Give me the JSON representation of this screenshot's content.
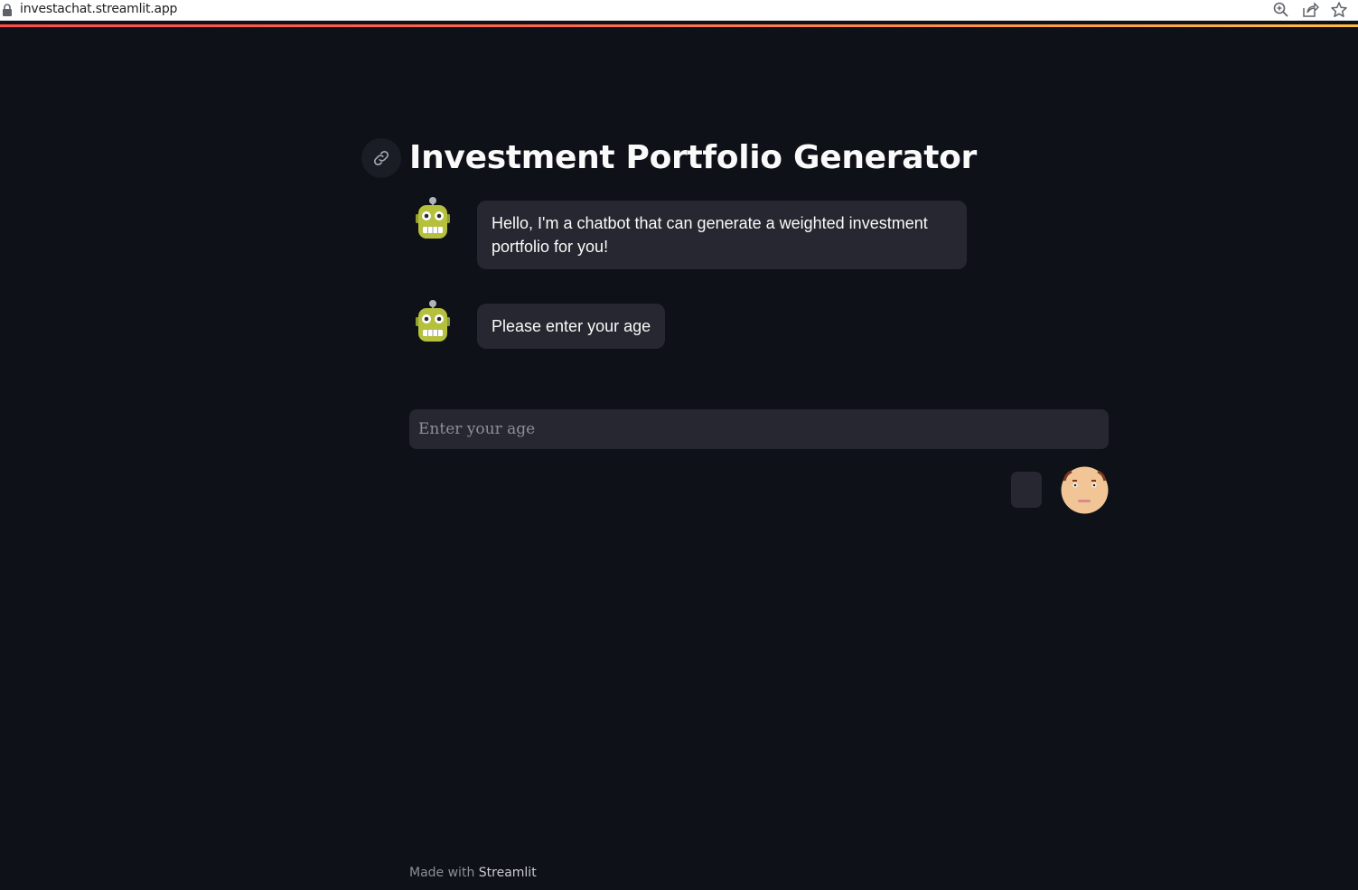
{
  "browser": {
    "url": "investachat.streamlit.app",
    "icons": [
      "lock-icon",
      "zoom-icon",
      "share-icon",
      "bookmark-star-icon"
    ]
  },
  "colors": {
    "background": "#0e1117",
    "bubble": "#262730",
    "text": "#fafafa",
    "accent_gradient": [
      "#ff4b4b",
      "#ffbd45"
    ]
  },
  "header": {
    "title": "Investment Portfolio Generator",
    "anchor_icon": "link-icon"
  },
  "messages": [
    {
      "role": "bot",
      "avatar": "robot-icon",
      "text": "Hello, I'm a chatbot that can generate a weighted investment portfolio for you!"
    },
    {
      "role": "bot",
      "avatar": "robot-icon",
      "text": "Please enter your age"
    }
  ],
  "input": {
    "placeholder": "Enter your age",
    "value": ""
  },
  "user": {
    "avatar": "user-face-icon"
  },
  "footer": {
    "prefix": "Made with",
    "link": "Streamlit"
  }
}
